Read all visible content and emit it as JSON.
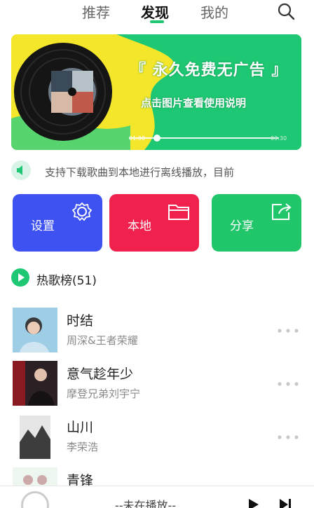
{
  "tabs": [
    "推荐",
    "发现",
    "我的"
  ],
  "banner": {
    "title": "『 永久免费无广告 』",
    "subtitle": "点击图片查看使用说明",
    "time_start": "01:00",
    "time_end": "03:30",
    "colors": {
      "bg": "#f4e62a",
      "wave": "#1ec773",
      "disc": "#151515"
    }
  },
  "notice": {
    "text": "支持下载歌曲到本地进行离线播放，目前"
  },
  "cards": [
    {
      "label": "设置",
      "icon": "gear-icon",
      "color": "#3d52f0"
    },
    {
      "label": "本地",
      "icon": "folder-icon",
      "color": "#f0224d"
    },
    {
      "label": "分享",
      "icon": "share-icon",
      "color": "#22c66a"
    }
  ],
  "section": {
    "title": "热歌榜(51)"
  },
  "songs": [
    {
      "title": "时结",
      "artist": "周深&王者荣耀"
    },
    {
      "title": "意气趁年少",
      "artist": "摩登兄弟刘宇宁"
    },
    {
      "title": "山川",
      "artist": "李荣浩"
    },
    {
      "title": "青锋",
      "artist": ""
    }
  ],
  "player": {
    "status": "--未在播放--"
  },
  "accent": "#1ec773"
}
